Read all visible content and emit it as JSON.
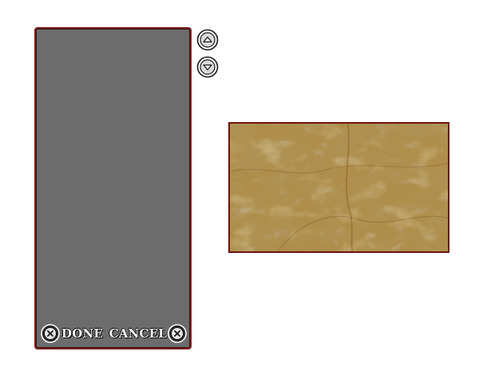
{
  "dialog": {
    "done_label": "DONE",
    "cancel_label": "CANCEL"
  },
  "icons": {
    "done": "close-circle-icon",
    "cancel": "close-circle-icon",
    "scroll_up": "arrow-up-circle-icon",
    "scroll_down": "arrow-down-circle-icon"
  },
  "colors": {
    "panel_background": "#6c6c6c",
    "panel_border": "#7a1f1f",
    "preview_border": "#6e1414",
    "texture_base": "#b08a3e",
    "button_text": "#ffffff"
  },
  "preview": {
    "texture": "parchment-marble"
  }
}
